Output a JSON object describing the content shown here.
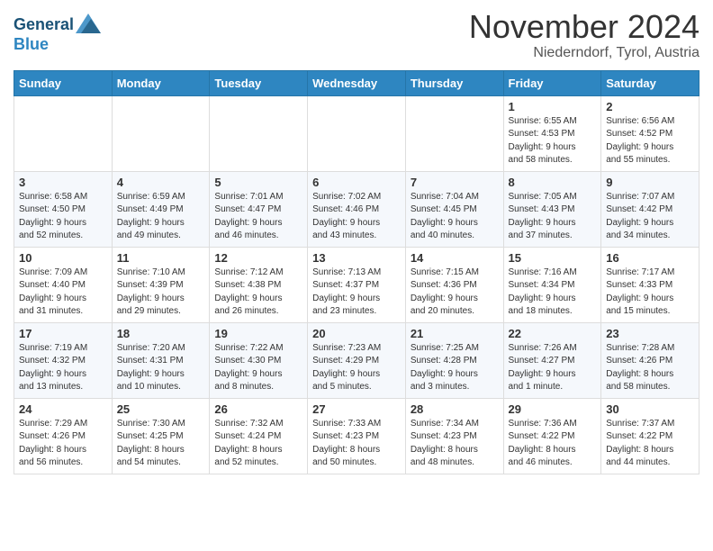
{
  "header": {
    "logo_line1": "General",
    "logo_line2": "Blue",
    "month": "November 2024",
    "location": "Niederndorf, Tyrol, Austria"
  },
  "weekdays": [
    "Sunday",
    "Monday",
    "Tuesday",
    "Wednesday",
    "Thursday",
    "Friday",
    "Saturday"
  ],
  "weeks": [
    {
      "row": 1,
      "days": [
        {
          "num": "",
          "info": ""
        },
        {
          "num": "",
          "info": ""
        },
        {
          "num": "",
          "info": ""
        },
        {
          "num": "",
          "info": ""
        },
        {
          "num": "",
          "info": ""
        },
        {
          "num": "1",
          "info": "Sunrise: 6:55 AM\nSunset: 4:53 PM\nDaylight: 9 hours\nand 58 minutes."
        },
        {
          "num": "2",
          "info": "Sunrise: 6:56 AM\nSunset: 4:52 PM\nDaylight: 9 hours\nand 55 minutes."
        }
      ]
    },
    {
      "row": 2,
      "days": [
        {
          "num": "3",
          "info": "Sunrise: 6:58 AM\nSunset: 4:50 PM\nDaylight: 9 hours\nand 52 minutes."
        },
        {
          "num": "4",
          "info": "Sunrise: 6:59 AM\nSunset: 4:49 PM\nDaylight: 9 hours\nand 49 minutes."
        },
        {
          "num": "5",
          "info": "Sunrise: 7:01 AM\nSunset: 4:47 PM\nDaylight: 9 hours\nand 46 minutes."
        },
        {
          "num": "6",
          "info": "Sunrise: 7:02 AM\nSunset: 4:46 PM\nDaylight: 9 hours\nand 43 minutes."
        },
        {
          "num": "7",
          "info": "Sunrise: 7:04 AM\nSunset: 4:45 PM\nDaylight: 9 hours\nand 40 minutes."
        },
        {
          "num": "8",
          "info": "Sunrise: 7:05 AM\nSunset: 4:43 PM\nDaylight: 9 hours\nand 37 minutes."
        },
        {
          "num": "9",
          "info": "Sunrise: 7:07 AM\nSunset: 4:42 PM\nDaylight: 9 hours\nand 34 minutes."
        }
      ]
    },
    {
      "row": 3,
      "days": [
        {
          "num": "10",
          "info": "Sunrise: 7:09 AM\nSunset: 4:40 PM\nDaylight: 9 hours\nand 31 minutes."
        },
        {
          "num": "11",
          "info": "Sunrise: 7:10 AM\nSunset: 4:39 PM\nDaylight: 9 hours\nand 29 minutes."
        },
        {
          "num": "12",
          "info": "Sunrise: 7:12 AM\nSunset: 4:38 PM\nDaylight: 9 hours\nand 26 minutes."
        },
        {
          "num": "13",
          "info": "Sunrise: 7:13 AM\nSunset: 4:37 PM\nDaylight: 9 hours\nand 23 minutes."
        },
        {
          "num": "14",
          "info": "Sunrise: 7:15 AM\nSunset: 4:36 PM\nDaylight: 9 hours\nand 20 minutes."
        },
        {
          "num": "15",
          "info": "Sunrise: 7:16 AM\nSunset: 4:34 PM\nDaylight: 9 hours\nand 18 minutes."
        },
        {
          "num": "16",
          "info": "Sunrise: 7:17 AM\nSunset: 4:33 PM\nDaylight: 9 hours\nand 15 minutes."
        }
      ]
    },
    {
      "row": 4,
      "days": [
        {
          "num": "17",
          "info": "Sunrise: 7:19 AM\nSunset: 4:32 PM\nDaylight: 9 hours\nand 13 minutes."
        },
        {
          "num": "18",
          "info": "Sunrise: 7:20 AM\nSunset: 4:31 PM\nDaylight: 9 hours\nand 10 minutes."
        },
        {
          "num": "19",
          "info": "Sunrise: 7:22 AM\nSunset: 4:30 PM\nDaylight: 9 hours\nand 8 minutes."
        },
        {
          "num": "20",
          "info": "Sunrise: 7:23 AM\nSunset: 4:29 PM\nDaylight: 9 hours\nand 5 minutes."
        },
        {
          "num": "21",
          "info": "Sunrise: 7:25 AM\nSunset: 4:28 PM\nDaylight: 9 hours\nand 3 minutes."
        },
        {
          "num": "22",
          "info": "Sunrise: 7:26 AM\nSunset: 4:27 PM\nDaylight: 9 hours\nand 1 minute."
        },
        {
          "num": "23",
          "info": "Sunrise: 7:28 AM\nSunset: 4:26 PM\nDaylight: 8 hours\nand 58 minutes."
        }
      ]
    },
    {
      "row": 5,
      "days": [
        {
          "num": "24",
          "info": "Sunrise: 7:29 AM\nSunset: 4:26 PM\nDaylight: 8 hours\nand 56 minutes."
        },
        {
          "num": "25",
          "info": "Sunrise: 7:30 AM\nSunset: 4:25 PM\nDaylight: 8 hours\nand 54 minutes."
        },
        {
          "num": "26",
          "info": "Sunrise: 7:32 AM\nSunset: 4:24 PM\nDaylight: 8 hours\nand 52 minutes."
        },
        {
          "num": "27",
          "info": "Sunrise: 7:33 AM\nSunset: 4:23 PM\nDaylight: 8 hours\nand 50 minutes."
        },
        {
          "num": "28",
          "info": "Sunrise: 7:34 AM\nSunset: 4:23 PM\nDaylight: 8 hours\nand 48 minutes."
        },
        {
          "num": "29",
          "info": "Sunrise: 7:36 AM\nSunset: 4:22 PM\nDaylight: 8 hours\nand 46 minutes."
        },
        {
          "num": "30",
          "info": "Sunrise: 7:37 AM\nSunset: 4:22 PM\nDaylight: 8 hours\nand 44 minutes."
        }
      ]
    }
  ]
}
